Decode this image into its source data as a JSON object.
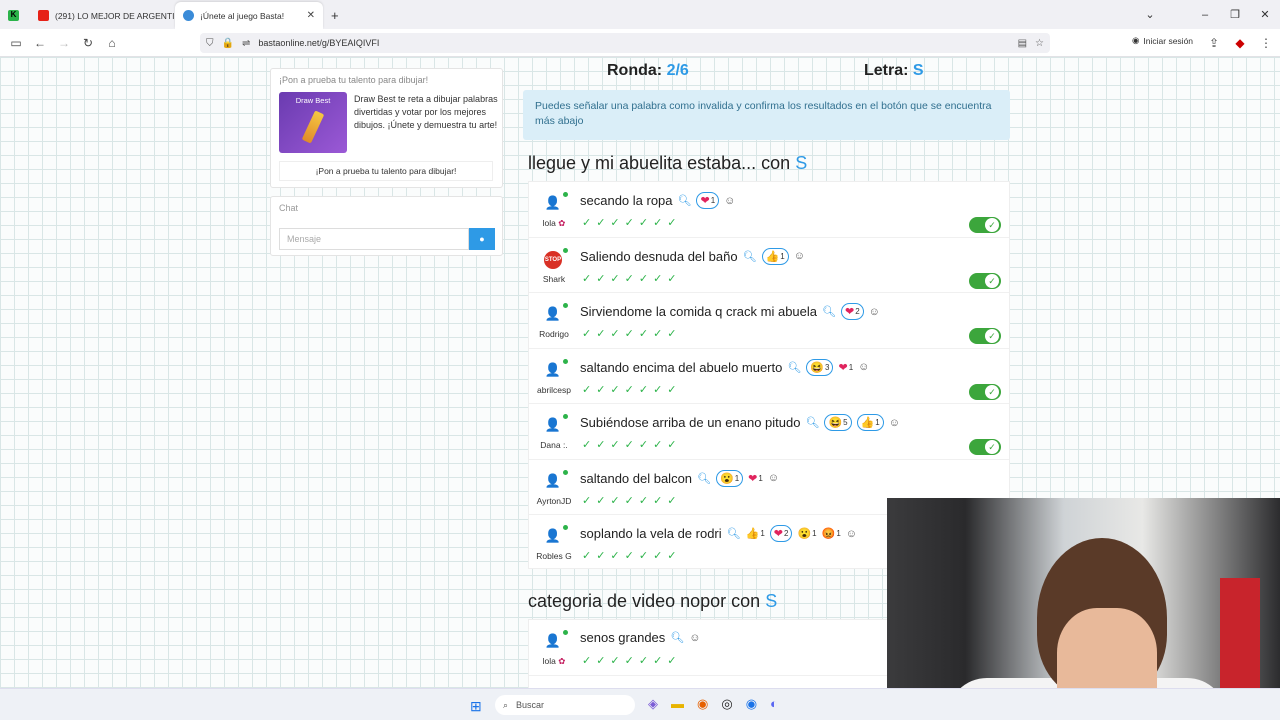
{
  "browser": {
    "tabs": [
      {
        "label": "(291) LO MEJOR DE ARGENTIN...",
        "color": "#e62117"
      },
      {
        "label": "¡Únete al juego Basta!",
        "color": "#3a8bd8"
      }
    ],
    "first_tab_icon": "k-icon",
    "new_tab": "+",
    "url": "bastaonline.net/g/BYEAIQIVFI",
    "signin": "Iniciar sesión"
  },
  "sidebar": {
    "promo_title": "¡Pon a prueba tu talento para dibujar!",
    "promo_image_label": "Draw Best",
    "promo_text": "Draw Best te reta a dibujar palabras divertidas y votar por los mejores dibujos. ¡Únete y demuestra tu arte!",
    "promo_button": "¡Pon a prueba tu talento para dibujar!",
    "chat_title": "Chat",
    "chat_placeholder": "Mensaje"
  },
  "game": {
    "round_label": "Ronda:",
    "round_value": "2/6",
    "letter_label": "Letra:",
    "letter_value": "S",
    "info": "Puedes señalar una palabra como invalida y confirma los resultados en el botón que se encuentra más abajo",
    "categories": [
      {
        "title": "llegue y mi abuelita estaba... con",
        "letter": "S",
        "entries": [
          {
            "user": "lola",
            "answer": "secando la ropa",
            "reactions": [
              {
                "emoji": "❤",
                "count": "1",
                "boxed": true
              }
            ]
          },
          {
            "user": "Shark",
            "answer": "Saliendo desnuda del baño",
            "reactions": [
              {
                "emoji": "👍",
                "count": "1",
                "boxed": true
              }
            ]
          },
          {
            "user": "Rodrigo",
            "answer": "Sirviendome la comida q crack mi abuela",
            "reactions": [
              {
                "emoji": "❤",
                "count": "2",
                "boxed": true
              }
            ]
          },
          {
            "user": "abrilcesp",
            "answer": "saltando encima del abuelo muerto",
            "reactions": [
              {
                "emoji": "😆",
                "count": "3",
                "boxed": true
              },
              {
                "emoji": "❤",
                "count": "1",
                "boxed": false
              }
            ]
          },
          {
            "user": "Dana :.",
            "answer": "Subiéndose arriba de un enano pitudo",
            "reactions": [
              {
                "emoji": "😆",
                "count": "5",
                "boxed": true
              },
              {
                "emoji": "👍",
                "count": "1",
                "boxed": true
              }
            ]
          },
          {
            "user": "AyrtonJD",
            "answer": "saltando del balcon",
            "reactions": [
              {
                "emoji": "😮",
                "count": "1",
                "boxed": true
              },
              {
                "emoji": "❤",
                "count": "1",
                "boxed": false
              }
            ]
          },
          {
            "user": "Robles G",
            "answer": "soplando la vela de rodri",
            "reactions": [
              {
                "emoji": "👍",
                "count": "1",
                "boxed": false
              },
              {
                "emoji": "❤",
                "count": "2",
                "boxed": true
              },
              {
                "emoji": "😮",
                "count": "1",
                "boxed": false
              },
              {
                "emoji": "😡",
                "count": "1",
                "boxed": false
              }
            ]
          }
        ]
      },
      {
        "title": "categoria de video nopor con",
        "letter": "S",
        "entries": [
          {
            "user": "lola",
            "answer": "senos grandes",
            "reactions": []
          }
        ]
      }
    ]
  },
  "taskbar": {
    "search": "Buscar"
  }
}
